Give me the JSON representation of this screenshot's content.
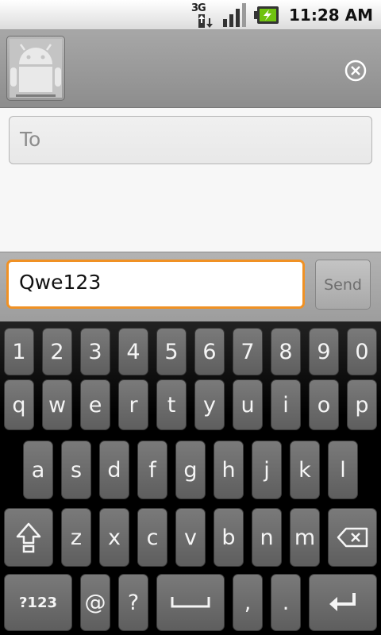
{
  "status_bar": {
    "time": "11:28 AM",
    "network_label": "3G",
    "icons": [
      "3g-data-icon",
      "signal-icon",
      "battery-charging-icon"
    ]
  },
  "header": {
    "avatar_icon": "android-robot-icon",
    "close_icon": "close-circle-icon"
  },
  "compose": {
    "to_placeholder": "To"
  },
  "message_bar": {
    "message_value": "Qwe123",
    "send_label": "Send"
  },
  "keyboard": {
    "row_numbers": [
      "1",
      "2",
      "3",
      "4",
      "5",
      "6",
      "7",
      "8",
      "9",
      "0"
    ],
    "row_top": [
      "q",
      "w",
      "e",
      "r",
      "t",
      "y",
      "u",
      "i",
      "o",
      "p"
    ],
    "row_home": [
      "a",
      "s",
      "d",
      "f",
      "g",
      "h",
      "j",
      "k",
      "l"
    ],
    "row_bottom": [
      "z",
      "x",
      "c",
      "v",
      "b",
      "n",
      "m"
    ],
    "row_space": {
      "symbols_label": "?123",
      "at": "@",
      "question": "?",
      "comma": ",",
      "period": "."
    },
    "icons": [
      "shift-icon",
      "backspace-icon",
      "spacebar-icon",
      "enter-icon"
    ]
  },
  "colors": {
    "input_focus_border": "#f09124",
    "key_face": "#6b6b6b",
    "header_bg": "#9a9a9a"
  }
}
